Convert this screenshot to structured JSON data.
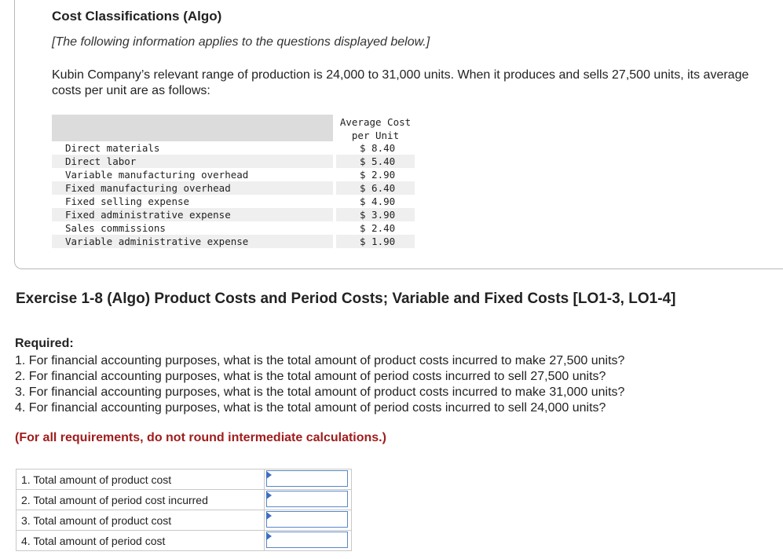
{
  "header": {
    "title": "Cost Classifications (Algo)",
    "note": "[The following information applies to the questions displayed below.]",
    "intro": "Kubin Company’s relevant range of production is 24,000 to 31,000 units. When it produces and sells 27,500 units, its average costs per unit are as follows:"
  },
  "cost_table": {
    "header_line1": "Average Cost",
    "header_line2": "per Unit",
    "rows": [
      {
        "label": "Direct materials",
        "value": "$ 8.40"
      },
      {
        "label": "Direct labor",
        "value": "$ 5.40"
      },
      {
        "label": "Variable manufacturing overhead",
        "value": "$ 2.90"
      },
      {
        "label": "Fixed manufacturing overhead",
        "value": "$ 6.40"
      },
      {
        "label": "Fixed selling expense",
        "value": "$ 4.90"
      },
      {
        "label": "Fixed administrative expense",
        "value": "$ 3.90"
      },
      {
        "label": "Sales commissions",
        "value": "$ 2.40"
      },
      {
        "label": "Variable administrative expense",
        "value": "$ 1.90"
      }
    ]
  },
  "exercise": {
    "title": "Exercise 1-8 (Algo) Product Costs and Period Costs; Variable and Fixed Costs [LO1-3, LO1-4]",
    "required_label": "Required:",
    "requirements": [
      "1. For financial accounting purposes, what is the total amount of product costs incurred to make 27,500 units?",
      "2. For financial accounting purposes, what is the total amount of period costs incurred to sell 27,500 units?",
      "3. For financial accounting purposes, what is the total amount of product costs incurred to make 31,000 units?",
      "4. For financial accounting purposes, what is the total amount of period costs incurred to sell 24,000 units?"
    ],
    "rounding_note": "(For all requirements, do not round intermediate calculations.)"
  },
  "answers": [
    {
      "label": "1. Total amount of product cost",
      "value": ""
    },
    {
      "label": "2. Total amount of period cost incurred",
      "value": ""
    },
    {
      "label": "3. Total amount of product cost",
      "value": ""
    },
    {
      "label": "4. Total amount of period cost",
      "value": ""
    }
  ]
}
